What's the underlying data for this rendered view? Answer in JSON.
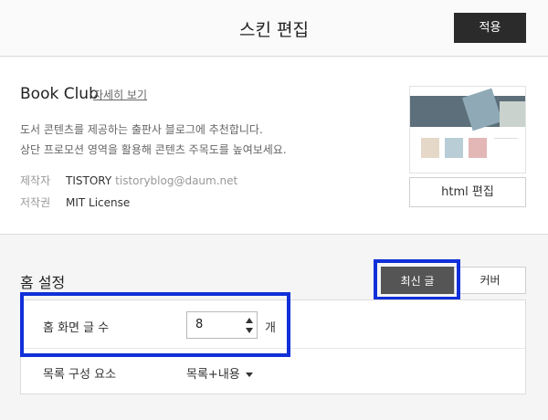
{
  "header": {
    "title": "스킨 편집",
    "apply_label": "적용"
  },
  "skin": {
    "name": "Book Club",
    "detail_link": "자세히 보기",
    "description": [
      "도서 콘텐츠를 제공하는 출판사 블로그에 추천합니다.",
      "상단 프로모션 영역을 활용해 콘텐츠 주목도를 높여보세요."
    ],
    "maker_label": "제작자",
    "maker_name": "TISTORY",
    "maker_email": "tistoryblog@daum.net",
    "license_label": "저작권",
    "license_value": "MIT License",
    "html_edit_label": "html 편집"
  },
  "home": {
    "title": "홈 설정",
    "tabs": [
      {
        "label": "최신 글",
        "active": true
      },
      {
        "label": "커버",
        "active": false
      }
    ],
    "post_count_label": "홈 화면 글 수",
    "post_count_value": "8",
    "post_count_unit": "개",
    "list_component_label": "목록 구성 요소",
    "list_component_value": "목록+내용"
  },
  "colors": {
    "highlight": "#1130d9",
    "primary_button": "#2b2b2b",
    "active_tab": "#555555"
  }
}
